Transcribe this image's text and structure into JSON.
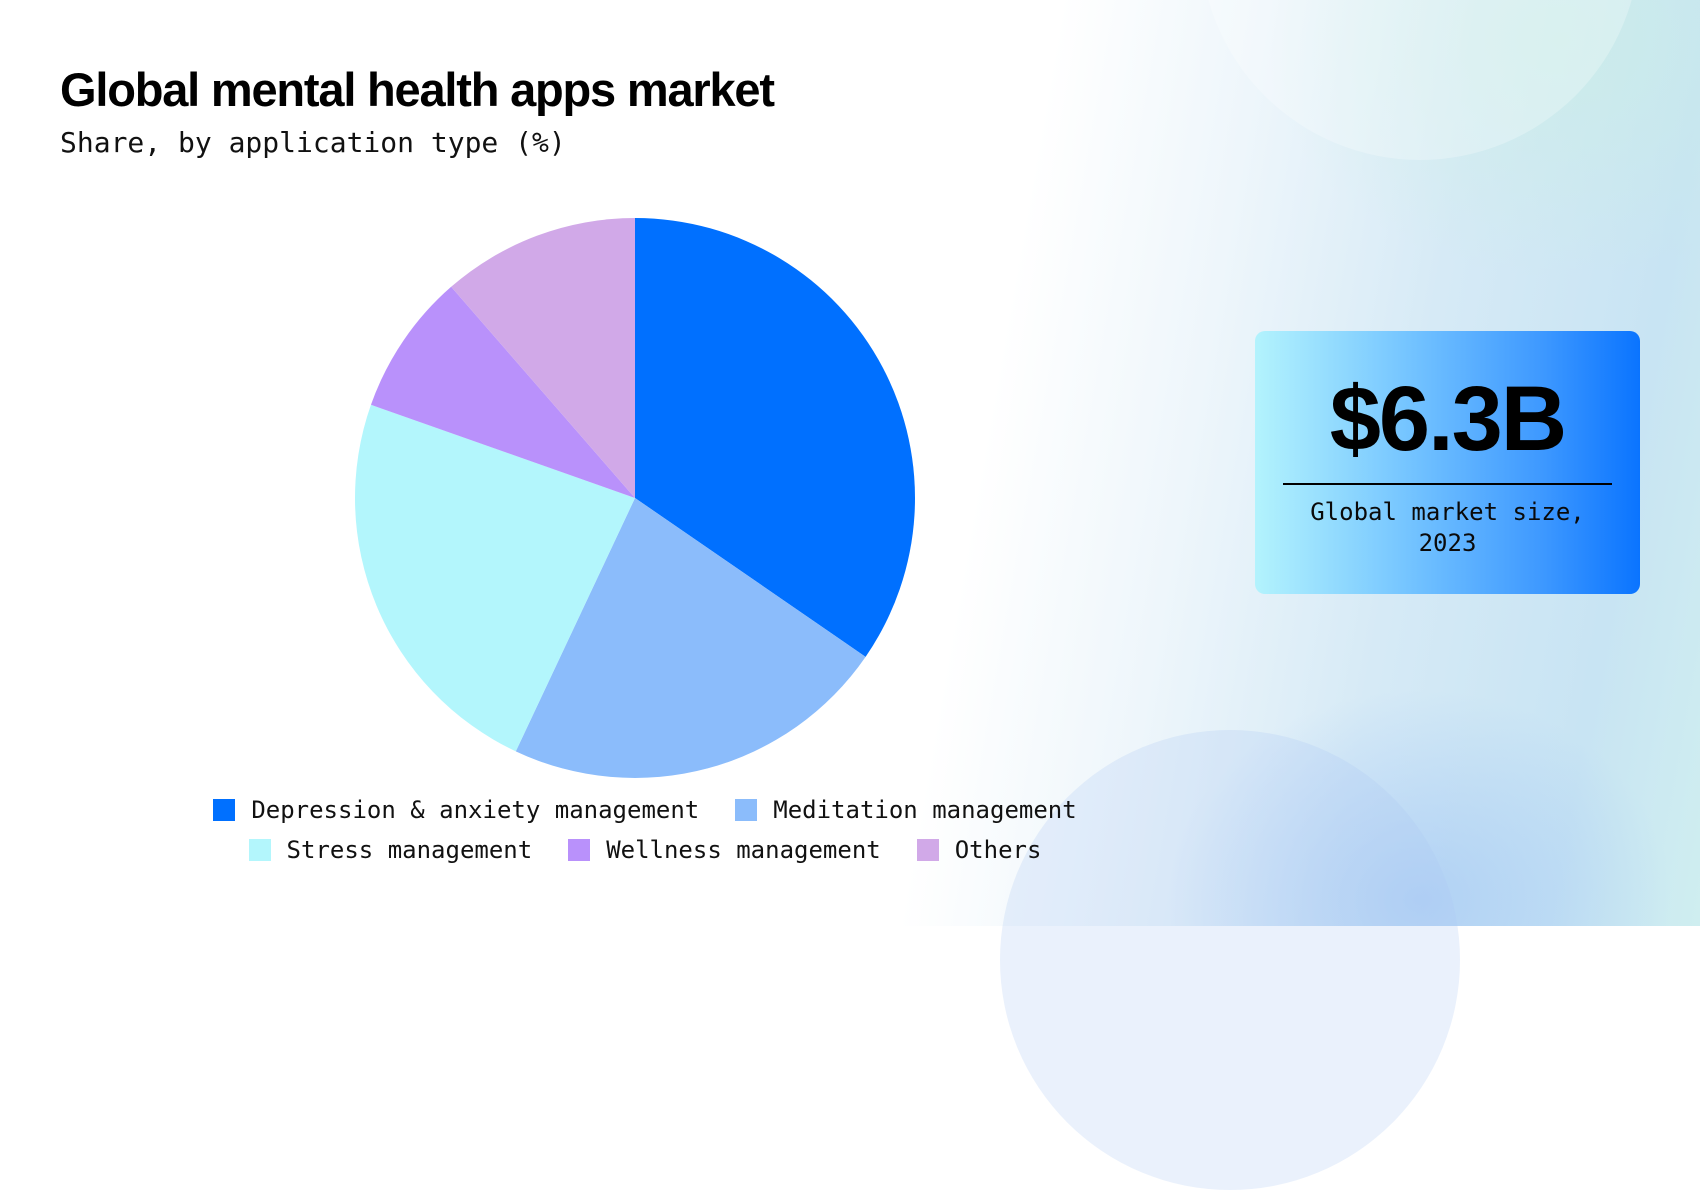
{
  "header": {
    "title": "Global mental health apps market",
    "subtitle": "Share, by application type (%)"
  },
  "chart_data": {
    "type": "pie",
    "title": "Global mental health apps market",
    "subtitle": "Share, by application type (%)",
    "start_angle": "12 o'clock",
    "direction": "clockwise",
    "legend_position": "bottom",
    "slices": [
      {
        "label": "Depression & anxiety management",
        "value": 34.6,
        "color": "#0070ff"
      },
      {
        "label": "Meditation management",
        "value": 22.4,
        "color": "#8bbcfb"
      },
      {
        "label": "Stress management",
        "value": 23.4,
        "color": "#b3f6fc"
      },
      {
        "label": "Wellness management",
        "value": 8.2,
        "color": "#b991fb"
      },
      {
        "label": "Others",
        "value": 11.4,
        "color": "#d1a9e8"
      }
    ]
  },
  "legend": {
    "rows": [
      [
        0,
        1
      ],
      [
        2,
        3,
        4
      ]
    ]
  },
  "callout": {
    "value": "$6.3B",
    "label_line1": "Global market size,",
    "label_line2": "2023"
  }
}
